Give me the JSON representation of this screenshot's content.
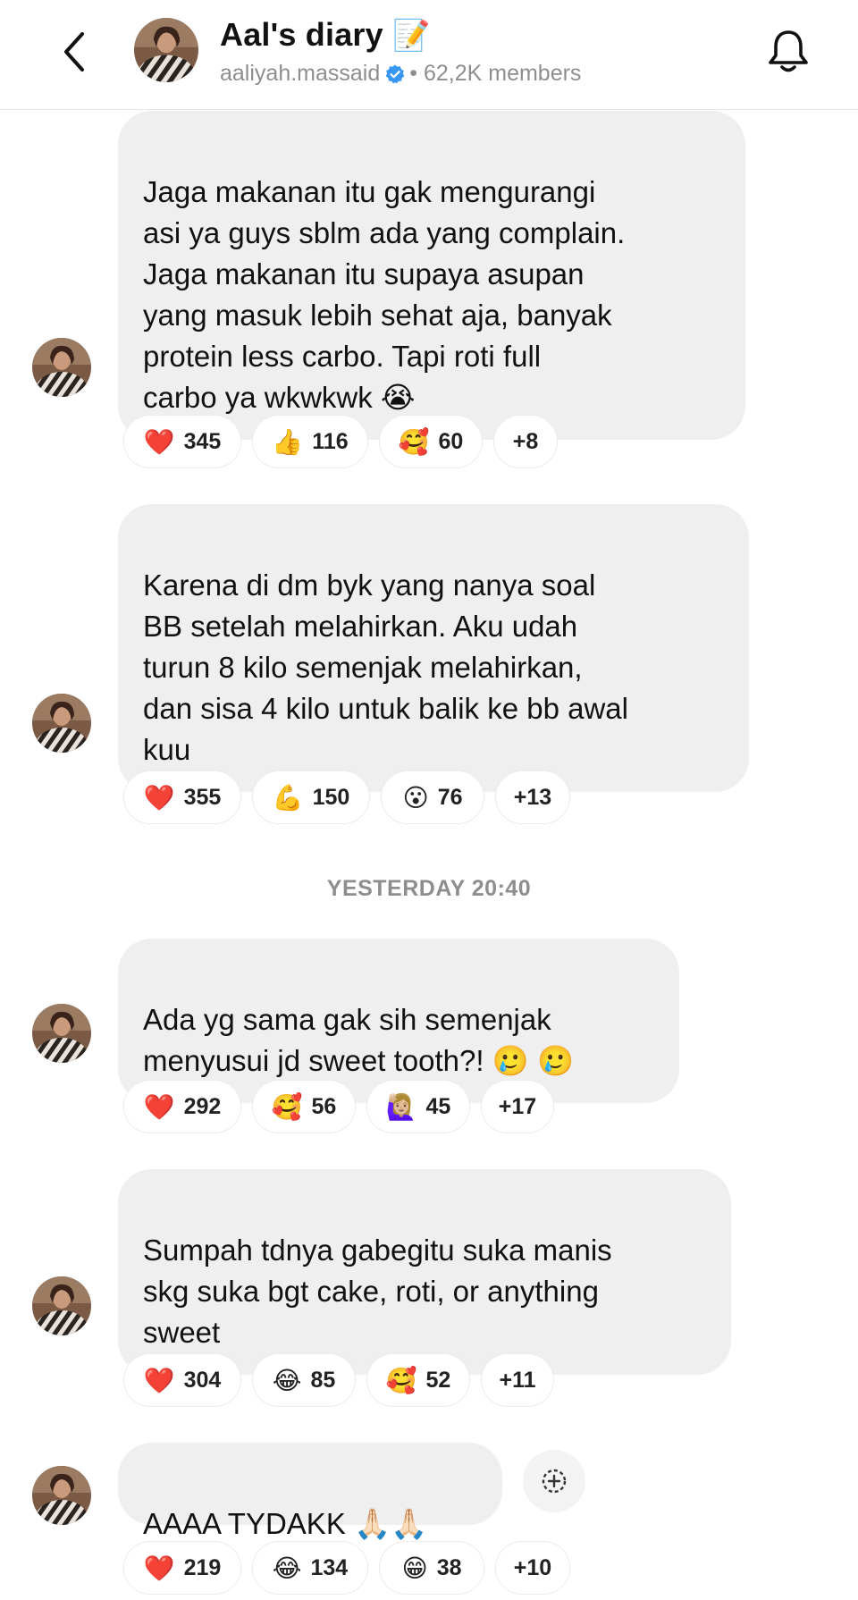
{
  "header": {
    "title": "Aal's diary",
    "title_emoji": "📝",
    "username": "aaliyah.massaid",
    "members": "• 62,2K members"
  },
  "messages": [
    {
      "text": "Jaga makanan itu gak mengurangi\nasi ya guys sblm ada yang complain.\nJaga makanan itu supaya asupan\nyang masuk lebih sehat aja, banyak\nprotein less carbo. Tapi roti full\ncarbo ya wkwkwk 😭",
      "reactions": [
        {
          "emoji": "❤️",
          "count": "345"
        },
        {
          "emoji": "👍",
          "count": "116"
        },
        {
          "emoji": "🥰",
          "count": "60"
        },
        {
          "emoji": "",
          "count": "+8"
        }
      ]
    },
    {
      "text": "Karena di dm byk yang nanya soal\nBB setelah melahirkan. Aku udah\nturun 8 kilo semenjak melahirkan,\ndan sisa 4 kilo untuk balik ke bb awal\nkuu",
      "reactions": [
        {
          "emoji": "❤️",
          "count": "355"
        },
        {
          "emoji": "💪",
          "count": "150"
        },
        {
          "emoji": "😮",
          "count": "76"
        },
        {
          "emoji": "",
          "count": "+13"
        }
      ]
    },
    {
      "text": "Ada yg sama gak sih semenjak\nmenyusui jd sweet tooth?! 🥲 🥲",
      "reactions": [
        {
          "emoji": "❤️",
          "count": "292"
        },
        {
          "emoji": "🥰",
          "count": "56"
        },
        {
          "emoji": "🙋🏼‍♀️",
          "count": "45"
        },
        {
          "emoji": "",
          "count": "+17"
        }
      ]
    },
    {
      "text": "Sumpah tdnya gabegitu suka manis\nskg suka bgt cake, roti, or anything\nsweet",
      "reactions": [
        {
          "emoji": "❤️",
          "count": "304"
        },
        {
          "emoji": "😂",
          "count": "85"
        },
        {
          "emoji": "🥰",
          "count": "52"
        },
        {
          "emoji": "",
          "count": "+11"
        }
      ]
    },
    {
      "text": "AAAA TYDAKK 🙏🏻🙏🏻",
      "reactions": [
        {
          "emoji": "❤️",
          "count": "219"
        },
        {
          "emoji": "😂",
          "count": "134"
        },
        {
          "emoji": "😁",
          "count": "38"
        },
        {
          "emoji": "",
          "count": "+10"
        }
      ]
    }
  ],
  "timestamp": "YESTERDAY 20:40",
  "colors": {
    "bubble": "#efefef",
    "muted": "#8e8e8e",
    "verified": "#3897f0"
  },
  "icons": {
    "back": "chevron-left-icon",
    "verified": "verified-badge-icon",
    "bell": "bell-icon",
    "add_reaction": "add-reaction-icon"
  }
}
